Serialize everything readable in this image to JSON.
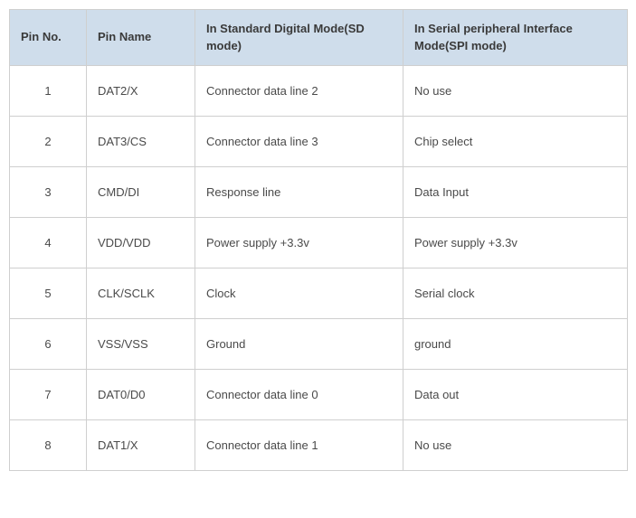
{
  "headers": {
    "pin_no": "Pin No.",
    "pin_name": "Pin Name",
    "sd_mode": "In Standard Digital Mode(SD mode)",
    "spi_mode": "In Serial peripheral Interface Mode(SPI mode)"
  },
  "rows": [
    {
      "pin_no": "1",
      "pin_name": "DAT2/X",
      "sd_mode": "Connector data line 2",
      "spi_mode": "No use"
    },
    {
      "pin_no": "2",
      "pin_name": "DAT3/CS",
      "sd_mode": "Connector data line 3",
      "spi_mode": "Chip select"
    },
    {
      "pin_no": "3",
      "pin_name": "CMD/DI",
      "sd_mode": "Response line",
      "spi_mode": "Data Input"
    },
    {
      "pin_no": "4",
      "pin_name": "VDD/VDD",
      "sd_mode": "Power supply +3.3v",
      "spi_mode": "Power supply +3.3v"
    },
    {
      "pin_no": "5",
      "pin_name": "CLK/SCLK",
      "sd_mode": "Clock",
      "spi_mode": "Serial clock"
    },
    {
      "pin_no": "6",
      "pin_name": "VSS/VSS",
      "sd_mode": "Ground",
      "spi_mode": "ground"
    },
    {
      "pin_no": "7",
      "pin_name": "DAT0/D0",
      "sd_mode": "Connector data line 0",
      "spi_mode": "Data out"
    },
    {
      "pin_no": "8",
      "pin_name": "DAT1/X",
      "sd_mode": "Connector data line 1",
      "spi_mode": "No use"
    }
  ]
}
